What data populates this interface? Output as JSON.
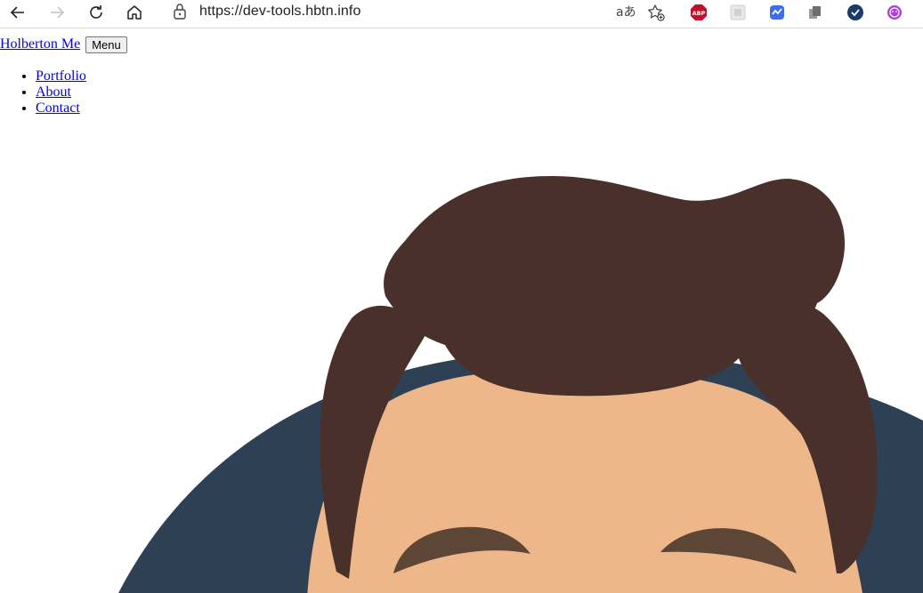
{
  "browser": {
    "url": "https://dev-tools.hbtn.info",
    "read_aloud": "aあ"
  },
  "header": {
    "brand": "Holberton Me",
    "menu_button": "Menu"
  },
  "nav": {
    "items": [
      "Portfolio",
      "About",
      "Contact"
    ]
  },
  "colors": {
    "link": "#0000ee",
    "hair": "#4a302b",
    "skin": "#edb78a",
    "eyebrow": "#5e4636",
    "background_circle": "#2e4154"
  },
  "extensions": [
    "adblock-plus-icon",
    "extension-grid-icon",
    "extension-chat-icon",
    "extension-copy-icon",
    "extension-check-icon",
    "extension-face-icon"
  ]
}
